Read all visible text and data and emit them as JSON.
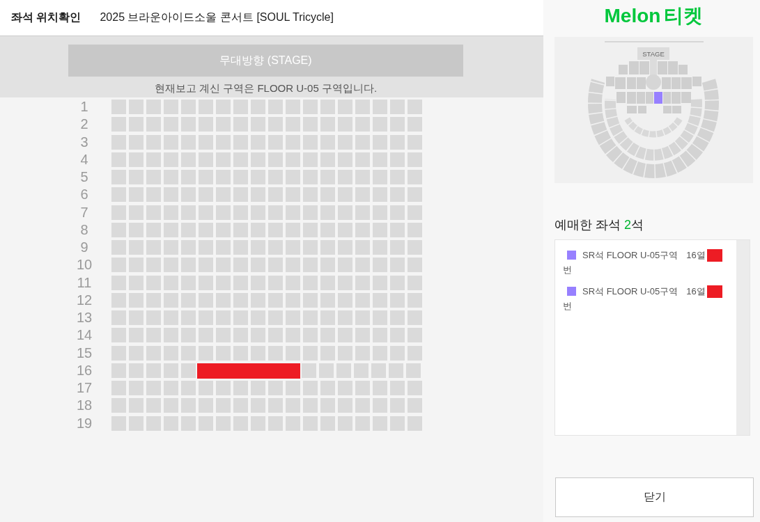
{
  "header": {
    "title": "좌석 위치확인",
    "event": "2025 브라운아이드소울 콘서트 [SOUL Tricycle]"
  },
  "stage": {
    "label": "무대방향 (STAGE)",
    "notice": "현재보고 계신 구역은 FLOOR U-05 구역입니다."
  },
  "seat_grid": {
    "rows": [
      {
        "label": "1",
        "covered": false
      },
      {
        "label": "2",
        "covered": false
      },
      {
        "label": "3",
        "covered": false
      },
      {
        "label": "4",
        "covered": false
      },
      {
        "label": "5",
        "covered": false
      },
      {
        "label": "6",
        "covered": false
      },
      {
        "label": "7",
        "covered": false
      },
      {
        "label": "8",
        "covered": false
      },
      {
        "label": "9",
        "covered": false
      },
      {
        "label": "10",
        "covered": false
      },
      {
        "label": "11",
        "covered": false
      },
      {
        "label": "12",
        "covered": false
      },
      {
        "label": "13",
        "covered": false
      },
      {
        "label": "14",
        "covered": false
      },
      {
        "label": "15",
        "covered": false
      },
      {
        "label": "16",
        "covered": true
      },
      {
        "label": "17",
        "covered": false
      },
      {
        "label": "18",
        "covered": false
      },
      {
        "label": "19",
        "covered": false
      }
    ]
  },
  "side_panel": {
    "logo": {
      "brand": "Melon",
      "service": "티켓"
    },
    "venue_map": {
      "stage_label": "STAGE"
    },
    "booked": {
      "title": "예매한 좌석",
      "count": "2",
      "unit": "석",
      "seats": [
        {
          "color": "#9780ff",
          "label": "SR석 FLOOR U-05구역",
          "row": "16열",
          "number_hidden": true,
          "suffix": "번"
        },
        {
          "color": "#9780ff",
          "label": "SR석 FLOOR U-05구역",
          "row": "16열",
          "number_hidden": true,
          "suffix": "번"
        }
      ]
    },
    "close_button": "닫기"
  }
}
